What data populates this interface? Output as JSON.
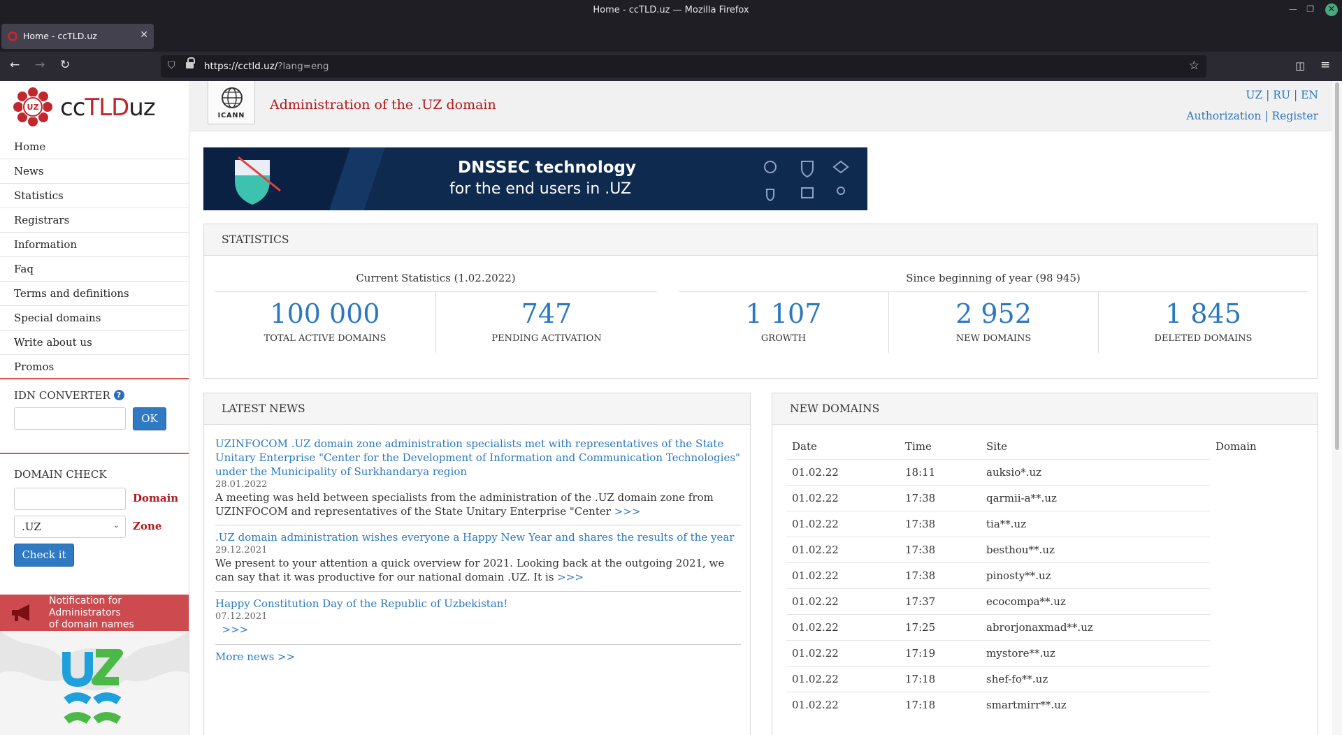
{
  "browser": {
    "window_title": "Home - ccTLD.uz — Mozilla Firefox",
    "tab_title": "Home - ccTLD.uz",
    "url_host": "https://cctld.uz/",
    "url_path": "?lang=eng"
  },
  "header": {
    "logo_prefix": "cc",
    "logo_tld": "TLD",
    "logo_suffix": "uz",
    "icann_label": "ICANN",
    "site_title": "Administration of the .UZ domain",
    "lang_uz": "UZ",
    "lang_ru": "RU",
    "lang_en": "EN",
    "authorization": "Authorization",
    "register": "Register"
  },
  "menu": {
    "items": [
      "Home",
      "News",
      "Statistics",
      "Registrars",
      "Information",
      "Faq",
      "Terms and definitions",
      "Special domains",
      "Write about us",
      "Promos"
    ]
  },
  "idn": {
    "title": "IDN CONVERTER",
    "ok": "OK",
    "value": ""
  },
  "domain_check": {
    "title": "DOMAIN CHECK",
    "domain_label": "Domain",
    "zone_label": "Zone",
    "zone_value": ".UZ",
    "button": "Check it"
  },
  "notification": {
    "line1": "Notification for",
    "line2": "Administrators",
    "line3": "of domain names"
  },
  "banner": {
    "line1": "DNSSEC technology",
    "line2": "for the end users in .UZ"
  },
  "statistics": {
    "title": "STATISTICS",
    "current_caption": "Current Statistics (1.02.2022)",
    "year_caption": "Since beginning of year (98 945)",
    "items": [
      {
        "value": "100 000",
        "label": "TOTAL ACTIVE DOMAINS"
      },
      {
        "value": "747",
        "label": "PENDING ACTIVATION"
      },
      {
        "value": "1 107",
        "label": "GROWTH"
      },
      {
        "value": "2 952",
        "label": "NEW DOMAINS"
      },
      {
        "value": "1 845",
        "label": "DELETED DOMAINS"
      }
    ]
  },
  "news": {
    "title": "LATEST NEWS",
    "items": [
      {
        "headline": "UZINFOCOM .UZ domain zone administration specialists met with representatives of the State Unitary Enterprise \"Center for the Development of Information and Communication Technologies\" under the Municipality of Surkhandarya region",
        "date": "28.01.2022",
        "excerpt": "A meeting was held between specialists from the administration of the .UZ domain zone from UZINFOCOM and representatives of the State Unitary Enterprise \"Center",
        "more": ">>>"
      },
      {
        "headline": ".UZ domain administration wishes everyone a Happy New Year and shares the results of the year",
        "date": "29.12.2021",
        "excerpt": "We present to your attention a quick overview for 2021. Looking back at the outgoing 2021, we can say that it was productive for our national domain .UZ. It is",
        "more": ">>>"
      },
      {
        "headline": "Happy Constitution Day of the Republic of Uzbekistan!",
        "date": "07.12.2021",
        "excerpt": "",
        "more": ">>>"
      }
    ],
    "more_news": "More news >>"
  },
  "new_domains": {
    "title": "NEW DOMAINS",
    "columns": [
      "Date",
      "Time",
      "Site",
      "Domain"
    ],
    "rows": [
      [
        "01.02.22",
        "18:11",
        "auksio*.uz"
      ],
      [
        "01.02.22",
        "17:38",
        "qarmii-a**.uz"
      ],
      [
        "01.02.22",
        "17:38",
        "tia**.uz"
      ],
      [
        "01.02.22",
        "17:38",
        "besthou**.uz"
      ],
      [
        "01.02.22",
        "17:38",
        "pinosty**.uz"
      ],
      [
        "01.02.22",
        "17:37",
        "ecocompa**.uz"
      ],
      [
        "01.02.22",
        "17:25",
        "abrorjonaxmad**.uz"
      ],
      [
        "01.02.22",
        "17:19",
        "mystore**.uz"
      ],
      [
        "01.02.22",
        "17:18",
        "shef-fo**.uz"
      ],
      [
        "01.02.22",
        "17:18",
        "smartmirr**.uz"
      ]
    ]
  }
}
